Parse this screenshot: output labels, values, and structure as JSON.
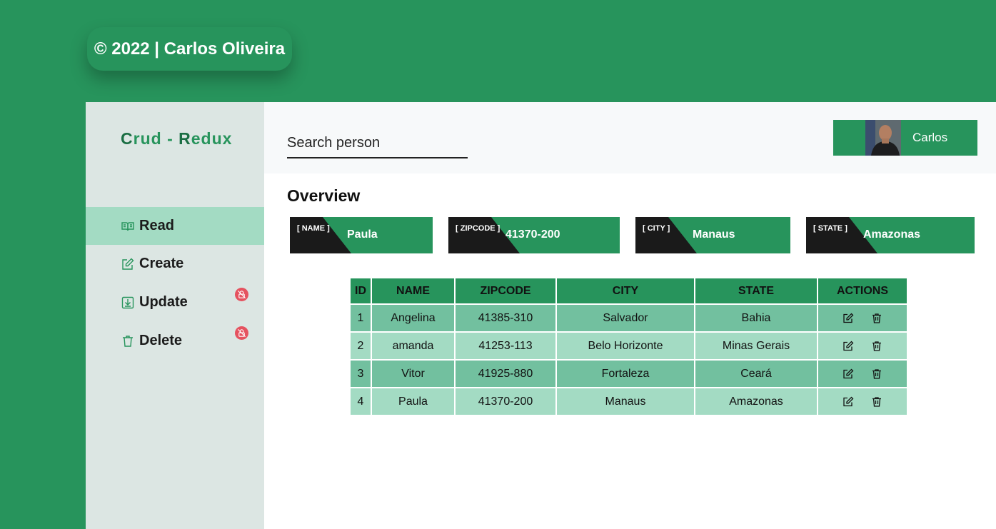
{
  "footer": {
    "copyright": "© 2022 | Carlos Oliveira"
  },
  "sidebar": {
    "logo_first": "C",
    "logo_rest": "rud - ",
    "logo_r": "R",
    "logo_end": "edux",
    "items": [
      {
        "label": "Read",
        "icon": "book-icon",
        "active": true,
        "locked": false
      },
      {
        "label": "Create",
        "icon": "edit-icon",
        "active": false,
        "locked": false
      },
      {
        "label": "Update",
        "icon": "download-icon",
        "active": false,
        "locked": true
      },
      {
        "label": "Delete",
        "icon": "trash-icon",
        "active": false,
        "locked": true
      }
    ]
  },
  "search": {
    "placeholder": "Search person"
  },
  "user": {
    "name": "Carlos"
  },
  "overview": {
    "title": "Overview",
    "stats": [
      {
        "label": "[ NAME ]",
        "value": "Paula"
      },
      {
        "label": "[ ZIPCODE ]",
        "value": "41370-200"
      },
      {
        "label": "[ CITY ]",
        "value": "Manaus"
      },
      {
        "label": "[ STATE ]",
        "value": "Amazonas"
      }
    ]
  },
  "table": {
    "headers": [
      "ID",
      "NAME",
      "ZIPCODE",
      "CITY",
      "STATE",
      "ACTIONS"
    ],
    "rows": [
      [
        "1",
        "Angelina",
        "41385-310",
        "Salvador",
        "Bahia"
      ],
      [
        "2",
        "amanda",
        "41253-113",
        "Belo Horizonte",
        "Minas Gerais"
      ],
      [
        "3",
        "Vitor",
        "41925-880",
        "Fortaleza",
        "Ceará"
      ],
      [
        "4",
        "Paula",
        "41370-200",
        "Manaus",
        "Amazonas"
      ]
    ]
  },
  "colors": {
    "brand": "#27945c",
    "sidebar_bg": "#dce6e3",
    "active_bg": "#a3dbc3",
    "row_dark": "#72c09f",
    "row_light": "#a3dbc3",
    "lock_badge": "#e5525f"
  }
}
